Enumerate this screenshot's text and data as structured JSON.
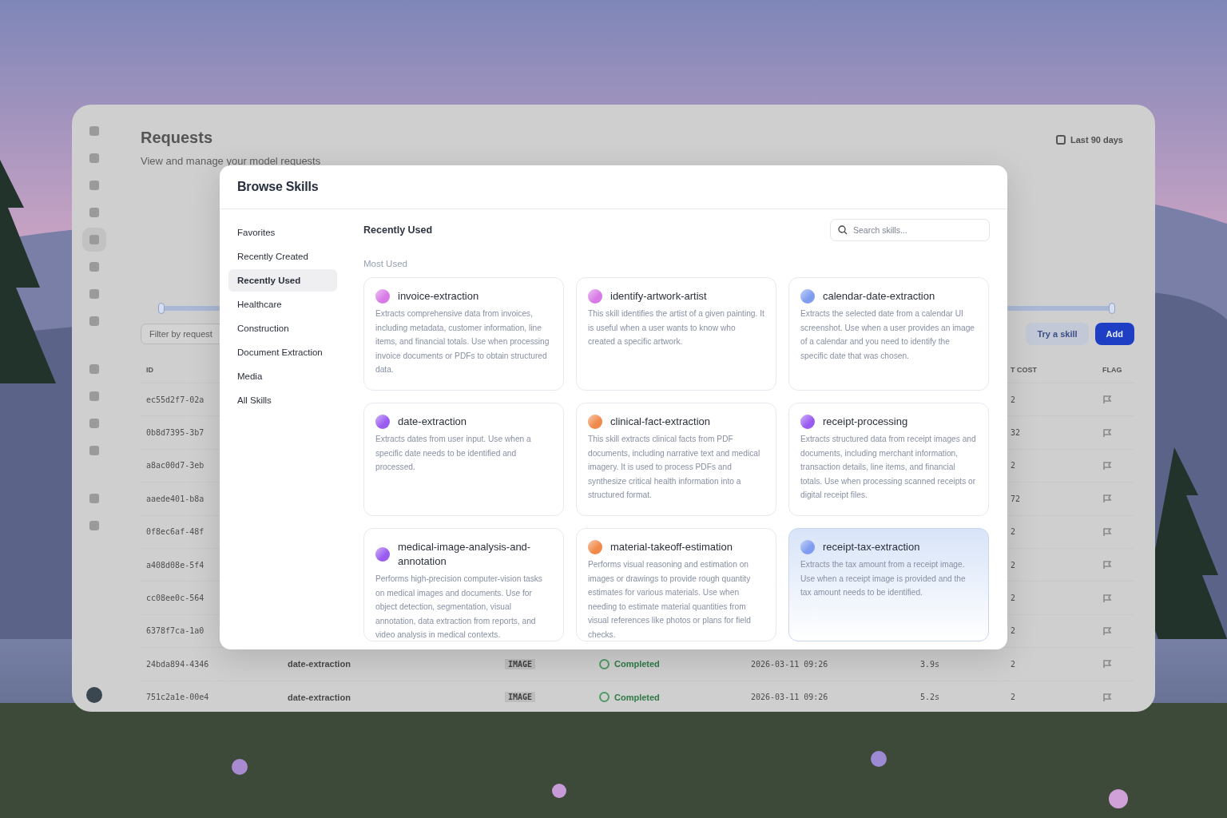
{
  "background_app": {
    "title": "Requests",
    "subtitle": "View and manage your model requests",
    "date_range": "Last 90 days",
    "range_slider": {
      "level": 1
    },
    "filter": {
      "placeholder": "Filter by request"
    },
    "buttons": [
      {
        "label": "Try a skill",
        "kind": "secondary"
      },
      {
        "label": "Add",
        "kind": "primary"
      }
    ],
    "table": {
      "header": {
        "id": "ID",
        "column_7": "T COST",
        "flag": "FLAG"
      },
      "rows": [
        {
          "id": "ec55d2f7-02a",
          "cost": "2"
        },
        {
          "id": "0b8d7395-3b7",
          "cost": "32"
        },
        {
          "id": "a8ac00d7-3eb",
          "cost": "2"
        },
        {
          "id": "aaede401-b8a",
          "cost": "72"
        },
        {
          "id": "0f8ec6af-48f",
          "cost": "2"
        },
        {
          "id": "a408d08e-5f4",
          "cost": "2"
        },
        {
          "id": "cc08ee0c-564",
          "cost": "2"
        },
        {
          "id": "6378f7ca-1a0",
          "cost": "2"
        },
        {
          "id": "24bda894-4346",
          "skill": "date-extraction",
          "type": "IMAGE",
          "status": "Completed",
          "created": "2026-03-11 09:26",
          "duration": "3.9s",
          "cost": "2"
        },
        {
          "id": "751c2a1e-00e4",
          "skill": "date-extraction",
          "type": "IMAGE",
          "status": "Completed",
          "created": "2026-03-11 09:26",
          "duration": "5.2s",
          "cost": "2"
        }
      ]
    }
  },
  "modal": {
    "title": "Browse Skills",
    "categories": [
      {
        "label": "Favorites",
        "selected": false
      },
      {
        "label": "Recently Created",
        "selected": false
      },
      {
        "label": "Recently Used",
        "selected": true
      },
      {
        "label": "Healthcare",
        "selected": false
      },
      {
        "label": "Construction",
        "selected": false
      },
      {
        "label": "Document Extraction",
        "selected": false
      },
      {
        "label": "Media",
        "selected": false
      },
      {
        "label": "All Skills",
        "selected": false
      }
    ],
    "heading": "Recently Used",
    "search": {
      "placeholder": "Search skills..."
    },
    "section": "Most Used",
    "skills": [
      {
        "name": "invoice-extraction",
        "description": "Extracts comprehensive data from invoices, including metadata, customer information, line items, and financial totals. Use when processing invoice documents or PDFs to obtain structured data.",
        "color": "#d77ae6",
        "selected": false
      },
      {
        "name": "identify-artwork-artist",
        "description": "This skill identifies the artist of a given painting. It is useful when a user wants to know who created a specific artwork.",
        "color": "#d77ae6",
        "selected": false
      },
      {
        "name": "calendar-date-extraction",
        "description": "Extracts the selected date from a calendar UI screenshot. Use when a user provides an image of a calendar and you need to identify the specific date that was chosen.",
        "color": "#7f9cf0",
        "selected": false
      },
      {
        "name": "date-extraction",
        "description": "Extracts dates from user input. Use when a specific date needs to be identified and processed.",
        "color": "#9a5cf0",
        "selected": false
      },
      {
        "name": "clinical-fact-extraction",
        "description": "This skill extracts clinical facts from PDF documents, including narrative text and medical imagery. It is used to process PDFs and synthesize critical health information into a structured format.",
        "color": "#f08a4b",
        "selected": false
      },
      {
        "name": "receipt-processing",
        "description": "Extracts structured data from receipt images and documents, including merchant information, transaction details, line items, and financial totals. Use when processing scanned receipts or digital receipt files.",
        "color": "#9a5cf0",
        "selected": false
      },
      {
        "name": "medical-image-analysis-and-annotation",
        "description": "Performs high-precision computer-vision tasks on medical images and documents. Use for object detection, segmentation, visual annotation, data extraction from reports, and video analysis in medical contexts.",
        "color": "#9a5cf0",
        "selected": false
      },
      {
        "name": "material-takeoff-estimation",
        "description": "Performs visual reasoning and estimation on images or drawings to provide rough quantity estimates for various materials. Use when needing to estimate material quantities from visual references like photos or plans for field checks.",
        "color": "#f08a4b",
        "selected": false
      },
      {
        "name": "receipt-tax-extraction",
        "description": "Extracts the tax amount from a receipt image. Use when a receipt image is provided and the tax amount needs to be identified.",
        "color": "#7f9cf0",
        "selected": true
      }
    ]
  }
}
